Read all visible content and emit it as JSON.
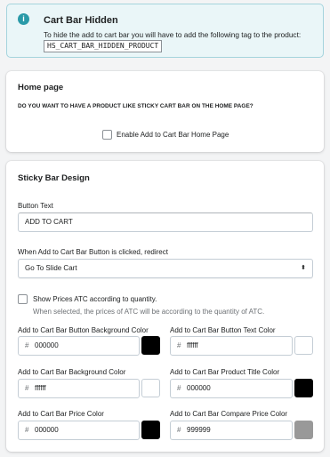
{
  "banner": {
    "title": "Cart Bar Hidden",
    "text": "To hide the add to cart bar you will have to add the following tag to the product:",
    "code": "HS_CART_BAR_HIDDEN_PRODUCT",
    "icon": "info-icon"
  },
  "home": {
    "title": "Home page",
    "question": "DO YOU WANT TO HAVE A PRODUCT LIKE STICKY CART BAR ON THE HOME PAGE?",
    "checkbox_label": "Enable Add to Cart Bar Home Page",
    "checked": false
  },
  "design": {
    "title": "Sticky Bar Design",
    "button_text_label": "Button Text",
    "button_text_value": "ADD TO CART",
    "redirect_label": "When Add to Cart Bar Button is clicked, redirect",
    "redirect_value": "Go To Slide Cart",
    "show_prices_label": "Show Prices ATC according to quantity.",
    "show_prices_checked": false,
    "show_prices_hint": "When selected, the prices of ATC will be according to the quantity of ATC.",
    "colors": [
      {
        "label": "Add to Cart Bar Button Background Color",
        "value": "000000",
        "swatch": "#000000"
      },
      {
        "label": "Add to Cart Bar Button Text Color",
        "value": "ffffff",
        "swatch": "#ffffff"
      },
      {
        "label": "Add to Cart Bar Background Color",
        "value": "ffffff",
        "swatch": "#ffffff"
      },
      {
        "label": "Add to Cart Bar Product Title Color",
        "value": "000000",
        "swatch": "#000000"
      },
      {
        "label": "Add to Cart Bar Price Color",
        "value": "000000",
        "swatch": "#000000"
      },
      {
        "label": "Add to Cart Bar Compare Price Color",
        "value": "999999",
        "swatch": "#999999"
      }
    ]
  }
}
